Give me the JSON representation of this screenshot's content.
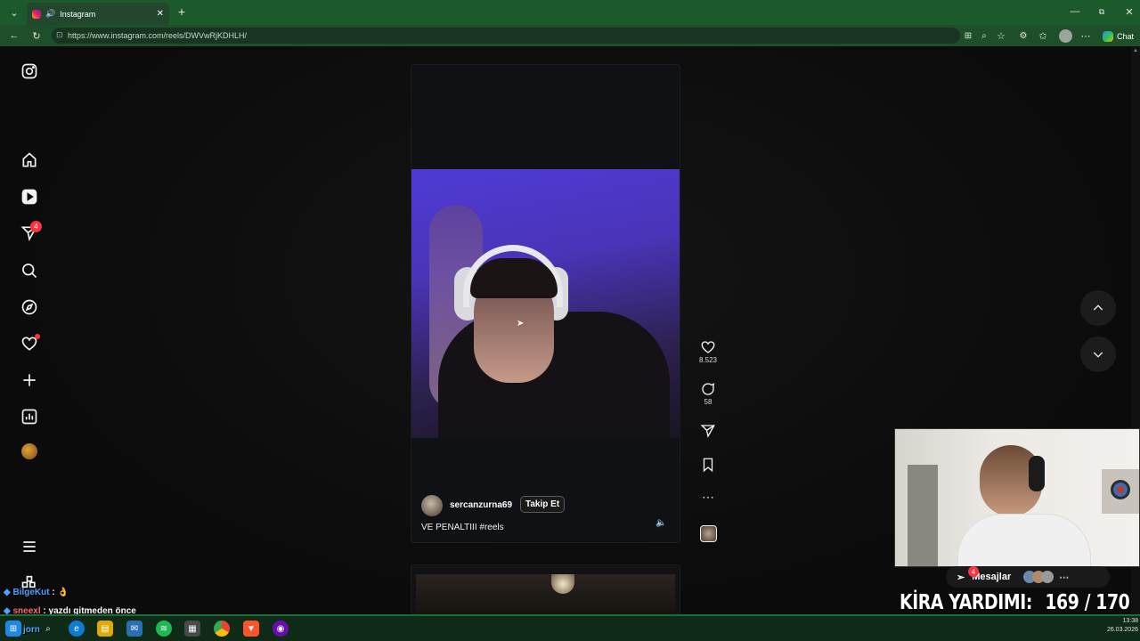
{
  "browser": {
    "tab_title": "Instagram",
    "url": "https://www.instagram.com/reels/DWVwRjKDHLH/",
    "chat_label": "Chat"
  },
  "sidebar": {
    "notification_count": "4"
  },
  "reel": {
    "username": "sercanzurna69",
    "follow_label": "Takip Et",
    "caption": "VE PENALTIII #reels",
    "likes": "8.523",
    "comments": "58"
  },
  "messages": {
    "label": "Mesajlar",
    "badge": "4"
  },
  "overlay": {
    "chat": [
      {
        "user": "BilgeKut",
        "text": ": 👌"
      },
      {
        "user": "sneexl",
        "text": ": yazdı gitmeden önce"
      }
    ],
    "rent_label": "KİRA YARDIMI:",
    "rent_progress": "169 / 170",
    "taskbar_partial_text": "jorn"
  },
  "taskbar": {
    "time": "13:38",
    "date": "26.03.2026"
  },
  "colors": {
    "browser_green": "#1d5a2b",
    "notification_red": "#ff3040",
    "accent_purple": "#4e3bd4"
  }
}
